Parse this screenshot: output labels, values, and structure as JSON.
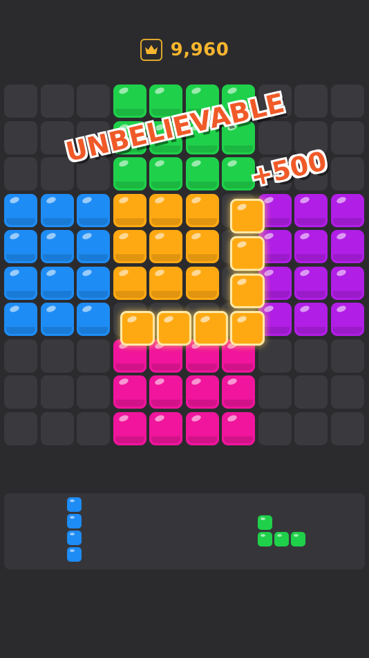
{
  "header": {
    "icon": "crown-icon",
    "score": "9,960"
  },
  "colors": {
    "green": "#1fd14a",
    "blue": "#1e8cf5",
    "orange": "#ffa912",
    "purple": "#b11ee6",
    "pink": "#f0159c",
    "empty": "#3a3a3e",
    "banner_text": "#f05a28",
    "score_text": "#f6b52e"
  },
  "board": {
    "rows": [
      [
        "E",
        "E",
        "E",
        "G",
        "G",
        "G",
        "G",
        "E",
        "E",
        "E"
      ],
      [
        "E",
        "E",
        "E",
        "G",
        "G",
        "G",
        "G",
        "E",
        "E",
        "E"
      ],
      [
        "E",
        "E",
        "E",
        "G",
        "G",
        "G",
        "G",
        "E",
        "E",
        "E"
      ],
      [
        "B",
        "B",
        "B",
        "O",
        "O",
        "O",
        "E",
        "P",
        "P",
        "P"
      ],
      [
        "B",
        "B",
        "B",
        "O",
        "O",
        "O",
        "E",
        "P",
        "P",
        "P"
      ],
      [
        "B",
        "B",
        "B",
        "O",
        "O",
        "O",
        "E",
        "P",
        "P",
        "P"
      ],
      [
        "B",
        "B",
        "B",
        "E",
        "E",
        "E",
        "E",
        "P",
        "P",
        "P"
      ],
      [
        "E",
        "E",
        "E",
        "K",
        "K",
        "K",
        "K",
        "E",
        "E",
        "E"
      ],
      [
        "E",
        "E",
        "E",
        "K",
        "K",
        "K",
        "K",
        "E",
        "E",
        "E"
      ],
      [
        "E",
        "E",
        "E",
        "K",
        "K",
        "K",
        "K",
        "E",
        "E",
        "E"
      ]
    ],
    "held_piece": {
      "color": "orange",
      "shape": "J"
    }
  },
  "combo": {
    "title": "UNBELIEVABLE",
    "bonus": "+500"
  },
  "tray": {
    "pieces": [
      {
        "name": "i-piece",
        "color": "blue",
        "shape": "I-vertical-4"
      },
      {
        "name": "l-piece",
        "color": "green",
        "shape": "L-small"
      }
    ]
  }
}
